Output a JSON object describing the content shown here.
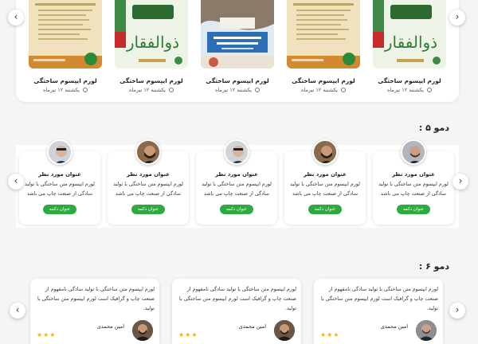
{
  "section1": {
    "items": [
      {
        "title": "لورم ایپسوم ساختگی",
        "date": "یکشنبه ۱۲ تیرماه"
      },
      {
        "title": "لورم ایپسوم ساختگی",
        "date": "یکشنبه ۱۲ تیرماه"
      },
      {
        "title": "لورم ایپسوم ساختگی",
        "date": "یکشنبه ۱۲ تیرماه"
      },
      {
        "title": "لورم ایپسوم ساختگی",
        "date": "یکشنبه ۱۲ تیرماه"
      },
      {
        "title": "لورم ایپسوم ساختگی",
        "date": "یکشنبه ۱۲ تیرماه"
      }
    ]
  },
  "section2": {
    "heading": "دمو ۵ :",
    "cards": [
      {
        "title": "عنوان مورد نظر",
        "line1": "لورم ایپسوم متن ساختگی با تولید",
        "line2": "سادگی از صنعت چاپ می باشد",
        "button": "عنوان دکمه"
      },
      {
        "title": "عنوان مورد نظر",
        "line1": "لورم ایپسوم متن ساختگی با تولید",
        "line2": "سادگی از صنعت چاپ می باشد",
        "button": "عنوان دکمه"
      },
      {
        "title": "عنوان مورد نظر",
        "line1": "لورم ایپسوم متن ساختگی با تولید",
        "line2": "سادگی از صنعت چاپ می باشد",
        "button": "عنوان دکمه"
      },
      {
        "title": "عنوان مورد نظر",
        "line1": "لورم ایپسوم متن ساختگی با تولید",
        "line2": "سادگی از صنعت چاپ می باشد",
        "button": "عنوان دکمه"
      },
      {
        "title": "عنوان مورد نظر",
        "line1": "لورم ایپسوم متن ساختگی با تولید",
        "line2": "سادگی از صنعت چاپ می باشد",
        "button": "عنوان دکمه"
      }
    ]
  },
  "section3": {
    "heading": "دمو ۶ :",
    "cards": [
      {
        "text": "لورم ایپسوم متن ساختگی با تولید سادگی نامفهوم از صنعت چاپ و گرافیک است لورم ایپسوم متن ساختگی با تولید.",
        "name": "امین محمدی",
        "stars": "★★★"
      },
      {
        "text": "لورم ایپسوم متن ساختگی با تولید سادگی نامفهوم از صنعت چاپ و گرافیک است لورم ایپسوم متن ساختگی با تولید.",
        "name": "امین محمدی",
        "stars": "★★★"
      },
      {
        "text": "لورم ایپسوم متن ساختگی با تولید سادگی نامفهوم از صنعت چاپ و گرافیک است لورم ایپسوم متن ساختگی با تولید.",
        "name": "امین محمدی",
        "stars": "★★★"
      }
    ]
  },
  "icons": {
    "prev": "‹",
    "next": "›"
  },
  "colors": {
    "button": "#2eaa40",
    "star": "#f5b400"
  }
}
